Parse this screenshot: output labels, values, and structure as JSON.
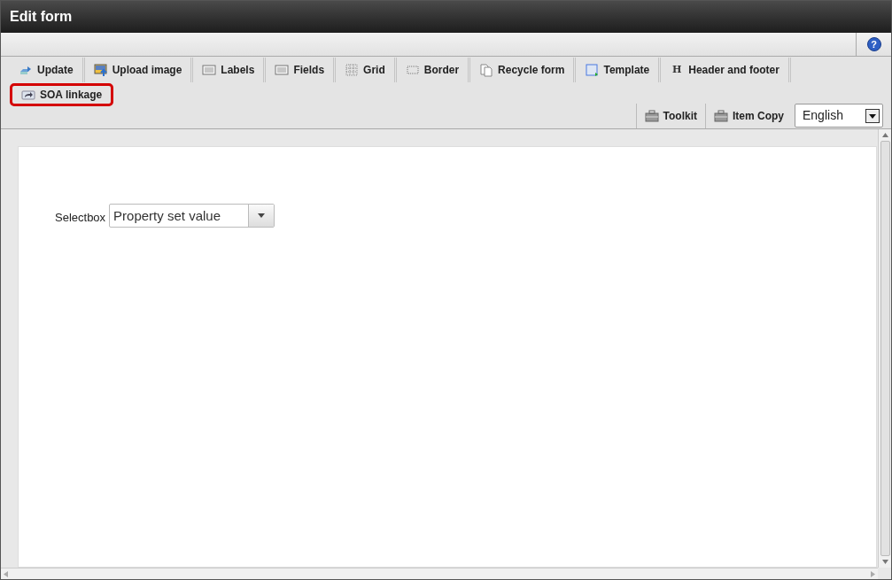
{
  "window": {
    "title": "Edit form"
  },
  "help": {
    "glyph": "?"
  },
  "tools": [
    {
      "label": "Update",
      "highlighted": false
    },
    {
      "label": "Upload image",
      "highlighted": false
    },
    {
      "label": "Labels",
      "highlighted": false
    },
    {
      "label": "Fields",
      "highlighted": false
    },
    {
      "label": "Grid",
      "highlighted": false
    },
    {
      "label": "Border",
      "highlighted": false
    },
    {
      "label": "Recycle form",
      "highlighted": false
    },
    {
      "label": "Template",
      "highlighted": false
    },
    {
      "label": "Header and footer",
      "highlighted": false,
      "glyph": "H"
    },
    {
      "label": "SOA linkage",
      "highlighted": true
    }
  ],
  "right_tools": [
    {
      "label": "Toolkit"
    },
    {
      "label": "Item Copy"
    }
  ],
  "language": {
    "value": "English"
  },
  "form": {
    "label": "Selectbox",
    "value": "Property set value"
  }
}
